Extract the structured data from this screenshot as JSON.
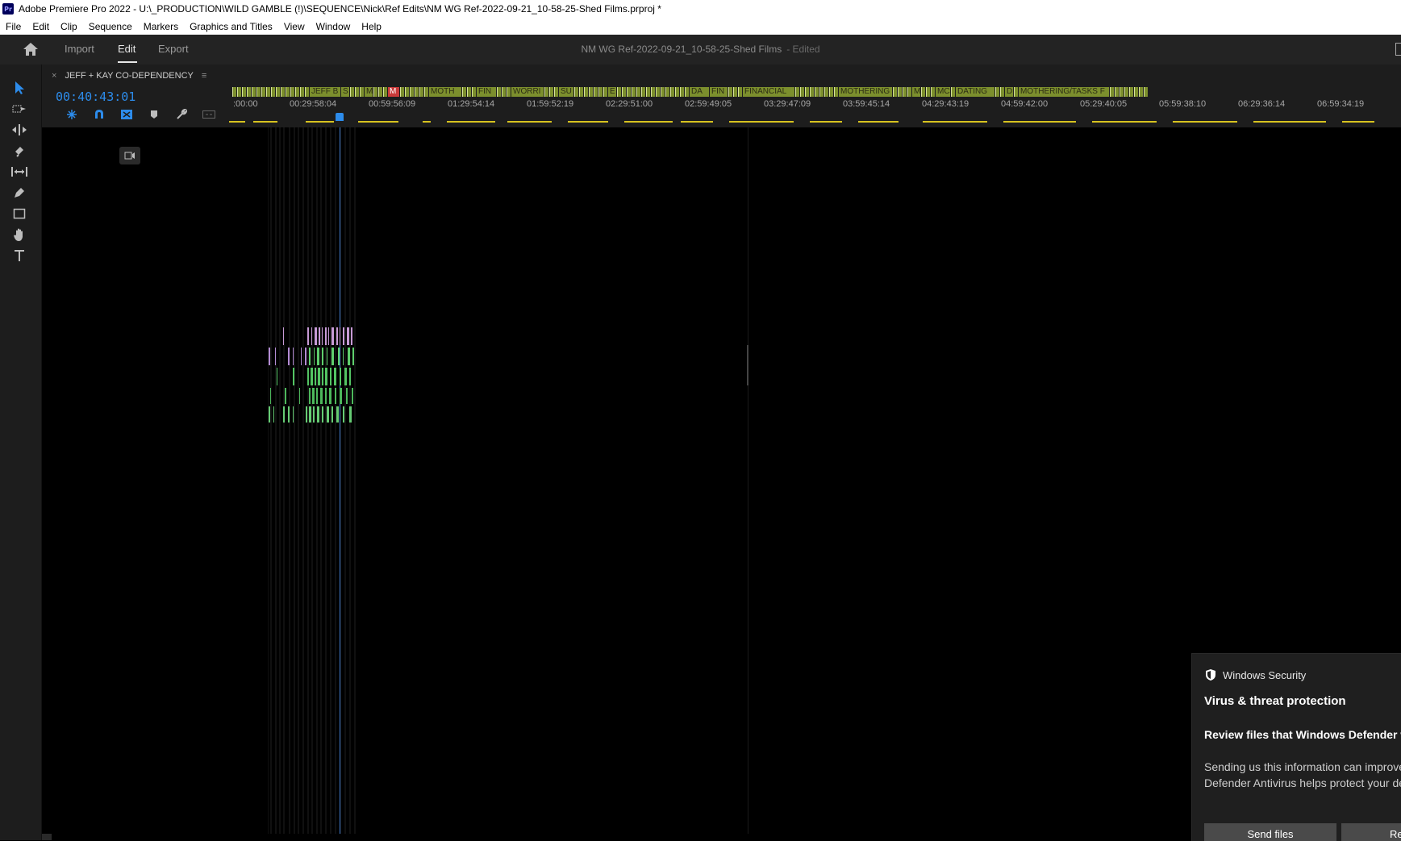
{
  "titlebar": {
    "logo": "Pr",
    "title": "Adobe Premiere Pro 2022 - U:\\_PRODUCTION\\WILD GAMBLE (!)\\SEQUENCE\\Nick\\Ref Edits\\NM WG Ref-2022-09-21_10-58-25-Shed Films.prproj *"
  },
  "menu": [
    "File",
    "Edit",
    "Clip",
    "Sequence",
    "Markers",
    "Graphics and Titles",
    "View",
    "Window",
    "Help"
  ],
  "workspace": {
    "tabs": [
      "Import",
      "Edit",
      "Export"
    ],
    "active_tab": "Edit",
    "project_title": "NM WG Ref-2022-09-21_10-58-25-Shed Films",
    "status": "- Edited"
  },
  "tools": [
    "selection-tool-icon",
    "track-select-icon",
    "ripple-edit-icon",
    "razor-icon",
    "slip-icon",
    "pen-icon",
    "rectangle-icon",
    "hand-icon",
    "type-icon"
  ],
  "timeline": {
    "close_symbol": "×",
    "sequence_name": "JEFF + KAY CO-DEPENDENCY",
    "menu_symbol": "≡",
    "timecode": "00:40:43:01",
    "markers": [
      "JEFF B",
      "S",
      "M",
      "M",
      "MOTH",
      "FIN",
      "WORRI",
      "SU",
      "E",
      "DA",
      "FIN",
      "FINANCIAL",
      "MOTHERING",
      "M",
      "MC",
      "DATING",
      "D",
      "MOTHERING/TASKS F"
    ],
    "ticks": [
      ":00:00",
      "00:29:58:04",
      "00:59:56:09",
      "01:29:54:14",
      "01:59:52:19",
      "02:29:51:00",
      "02:59:49:05",
      "03:29:47:09",
      "03:59:45:14",
      "04:29:43:19",
      "04:59:42:00",
      "05:29:40:05",
      "05:59:38:10",
      "06:29:36:14",
      "06:59:34:19"
    ],
    "playhead_color": "#2d8ceb",
    "marker_color": "#7c8f2d"
  },
  "toast": {
    "app": "Windows Security",
    "heading": "Virus & threat protection",
    "title": "Review files that Windows Defender will send to Microsoft",
    "body": "Sending us this information can improve how Microsoft Defender Antivirus helps protect your device.",
    "primary_button": "Send files",
    "secondary_button": "Review"
  }
}
